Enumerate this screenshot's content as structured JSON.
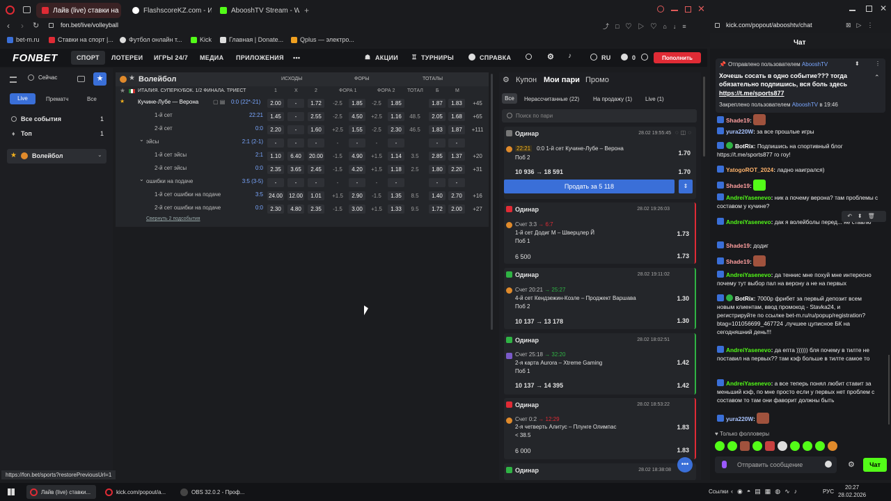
{
  "browser": {
    "tabs": [
      {
        "label": "Лайв (live) ставки на Вол",
        "color": "#e02b35",
        "active": true
      },
      {
        "label": "FlashscoreKZ.com - Избр",
        "color": "#ffffff",
        "active": false
      },
      {
        "label": "AbooshTV Stream - Watch",
        "color": "#53fc18",
        "active": false
      }
    ],
    "url_left": "fon.bet/live/volleyball",
    "url_right": "kick.com/popout/abooshtv/chat",
    "bookmarks": [
      "bet-m.ru",
      "Ставки на спорт |...",
      "Футбол онлайн т...",
      "Kick",
      "Главная | Donate...",
      "Qplus — электро..."
    ],
    "status_url": "https://fon.bet/sports?restorePreviousUrl=1"
  },
  "fonbet": {
    "logo": "FONBET",
    "nav": [
      "СПОРТ",
      "ЛОТЕРЕИ",
      "ИГРЫ 24/7",
      "МЕДИА",
      "ПРИЛОЖЕНИЯ",
      "•••"
    ],
    "actions": [
      "АКЦИИ",
      "ТУРНИРЫ",
      "СПРАВКА"
    ],
    "lang": "RU",
    "balance": "0",
    "deposit": "Пополнить",
    "sidebar": {
      "now": "Сейчас",
      "filters": [
        "Live",
        "Прематч",
        "Все"
      ],
      "items": [
        {
          "label": "Все события",
          "count": "1"
        },
        {
          "label": "Топ",
          "count": "1"
        }
      ],
      "sport": "Волейбол"
    },
    "table": {
      "sport": "Волейбол",
      "groups": [
        "ИСХОДЫ",
        "ФОРЫ",
        "ТОТАЛЫ"
      ],
      "league": "ИТАЛИЯ. СУПЕРКУБОК. 1/2 ФИНАЛА. ТРИЕСТ",
      "cols": [
        "1",
        "X",
        "2",
        "ФОРА 1",
        "ФОРА 2",
        "ТОТАЛ",
        "Б",
        "М"
      ],
      "rows": [
        {
          "name": "Кучине-Лубе — Верона",
          "score": "0:0 (22*-21)",
          "c": [
            "2.00",
            "-",
            "1.72",
            "-2.5",
            "1.85",
            "-2.5",
            "1.85",
            "",
            "1.87",
            "1.83",
            "+45"
          ],
          "main": true
        },
        {
          "name": "1-й сет",
          "score": "22:21",
          "c": [
            "1.45",
            "-",
            "2.55",
            "-2.5",
            "4.50",
            "+2.5",
            "1.16",
            "48.5",
            "2.05",
            "1.68",
            "+65"
          ]
        },
        {
          "name": "2-й сет",
          "score": "0:0",
          "c": [
            "2.20",
            "-",
            "1.60",
            "+2.5",
            "1.55",
            "-2.5",
            "2.30",
            "46.5",
            "1.83",
            "1.87",
            "+111"
          ]
        },
        {
          "name": "эйсы",
          "score": "2:1 (2-1)",
          "c": [
            "-",
            "-",
            "-",
            "-",
            "-",
            "-",
            "-",
            "",
            "-",
            "-",
            ""
          ],
          "group": true
        },
        {
          "name": "1-й сет эйсы",
          "score": "2:1",
          "c": [
            "1.10",
            "6.40",
            "20.00",
            "-1.5",
            "4.90",
            "+1.5",
            "1.14",
            "3.5",
            "2.85",
            "1.37",
            "+20"
          ]
        },
        {
          "name": "2-й сет эйсы",
          "score": "0:0",
          "c": [
            "2.35",
            "3.65",
            "2.45",
            "-1.5",
            "4.20",
            "+1.5",
            "1.18",
            "2.5",
            "1.80",
            "2.20",
            "+31"
          ]
        },
        {
          "name": "ошибки на подаче",
          "score": "3:5 (3-5)",
          "c": [
            "-",
            "-",
            "-",
            "-",
            "-",
            "-",
            "-",
            "",
            "-",
            "-",
            ""
          ],
          "group": true
        },
        {
          "name": "1-й сет ошибки на подаче",
          "score": "3:5",
          "c": [
            "24.00",
            "12.00",
            "1.01",
            "+1.5",
            "2.90",
            "-1.5",
            "1.35",
            "8.5",
            "1.40",
            "2.70",
            "+16"
          ]
        },
        {
          "name": "2-й сет ошибки на подаче",
          "score": "0:0",
          "c": [
            "2.30",
            "4.80",
            "2.35",
            "-1.5",
            "3.00",
            "+1.5",
            "1.33",
            "9.5",
            "1.72",
            "2.00",
            "+27"
          ]
        }
      ],
      "collapse": "Свернуть 2 подсобытия"
    },
    "coupon": {
      "tabs": [
        "Купон",
        "Мои пари",
        "Промо"
      ],
      "filters": [
        "Все",
        "Нерассчитанные (22)",
        "На продажу (1)",
        "Live (1)"
      ],
      "search_placeholder": "Поиск по пари",
      "sell_button": "Продать за 5 118",
      "bets": [
        {
          "type": "Одинар",
          "date": "28.02 19:55:45",
          "status": "#777777",
          "score": "22:21",
          "event": "0:0 1-й сет Кучине-Лубе – Верона",
          "pick": "Поб 2",
          "k": "1.70",
          "stake": "10 936 → 18 591",
          "k2": "1.70"
        },
        {
          "type": "Одинар",
          "date": "28.02 19:26:03",
          "status": "#e02b35",
          "score": "Счет 3:3",
          "score_live": "→ 6:7",
          "event": "1-й сет Додиг М – Шверцлер Й",
          "pick": "Поб 1",
          "k": "1.73",
          "stake": "6 500",
          "k2": "1.73"
        },
        {
          "type": "Одинар",
          "date": "28.02 19:11:02",
          "status": "#2fb344",
          "score": "Счет 20:21",
          "score_live": "→ 25:27",
          "event": "4-й сет Кендзежин-Козле – Проджект Варшава",
          "pick": "Поб 2",
          "k": "1.30",
          "stake": "10 137 → 13 178",
          "k2": "1.30"
        },
        {
          "type": "Одинар",
          "date": "28.02 18:02:51",
          "status": "#2fb344",
          "score": "Счет 25:18",
          "score_live": "→ 32:20",
          "event": "2-я карта Aurora – Xtreme Gaming",
          "pick": "Поб 1",
          "k": "1.42",
          "stake": "10 137 → 14 395",
          "k2": "1.42"
        },
        {
          "type": "Одинар",
          "date": "28.02 18:53:22",
          "status": "#e02b35",
          "score": "Счет 0:2",
          "score_live": "→ 12:29",
          "event": "2-я четверть Алитус – Плунге Олимпас",
          "pick": "< 38.5",
          "k": "1.83",
          "stake": "6 000",
          "k2": "1.83"
        },
        {
          "type": "Одинар",
          "date": "28.02 18:38:08",
          "status": "#2fb344"
        }
      ]
    }
  },
  "chat": {
    "title": "Чат",
    "pinned_by": "Отправлено пользователем",
    "pinned_user": "AbooshTV",
    "pinned_text": "Хочешь сосать в одно событие??? тогда обязательно подпишись, вся боль здесь",
    "pinned_link": "https://t.me/sports877",
    "pinned_footer": "Закреплено пользователем",
    "pinned_footer_user": "AbooshTV",
    "pinned_footer_time": "в 19:46",
    "messages": [
      {
        "user": "Shade19",
        "color": "#ff9f9f",
        "text": ""
      },
      {
        "user": "yura220W",
        "color": "#a9c4ff",
        "text": "за все прошлые игры"
      },
      {
        "user": "BotRix",
        "color": "#ffffff",
        "text": "Подпишись на спортивный блог https://t.me/sports877 го гоу!"
      },
      {
        "user": "YatogoROT_2024",
        "color": "#ffb36b",
        "text": "ладно наигрался)"
      },
      {
        "user": "Shade19",
        "color": "#ff9f9f",
        "text": ""
      },
      {
        "user": "AndreiYasenevo",
        "color": "#53fc18",
        "text": "ник а почему верона? там проблемы с составом у кучине?"
      },
      {
        "user": "AndreiYasenevo",
        "color": "#53fc18",
        "text": "дак я волейболы перед... не ставлю"
      },
      {
        "user": "Shade19",
        "color": "#ff9f9f",
        "text": "додиг"
      },
      {
        "user": "Shade19",
        "color": "#ff9f9f",
        "text": ""
      },
      {
        "user": "AndreiYasenevo",
        "color": "#53fc18",
        "text": "да теннис мне похуй мне интересно почему тут выбор пал на верону а не на первых"
      },
      {
        "user": "BotRix",
        "color": "#ffffff",
        "text": "7000р фрибет за первый депозит всем новым клиентам, ввод промокод - Stavka24, и регистрируйте по ссылке bet-m.ru/ru/popup/registration?btag=101056699_467724 ,лучшее цуписное БК на сегодняшний день!!!"
      },
      {
        "user": "AndreiYasenevo",
        "color": "#53fc18",
        "text": "да епта )))))) бля почему в тилте не поставил на первых?? там кэф больше в тилте самое то"
      },
      {
        "user": "AndreiYasenevo",
        "color": "#53fc18",
        "text": "а все теперь понял любит ставит за меньший кэф, по мне просто если у первых нет проблем с составом то там они фаворит должны быть"
      },
      {
        "user": "yura220W",
        "color": "#a9c4ff",
        "text": ""
      }
    ],
    "followers_only": "Только фолловеры",
    "input_placeholder": "Отправить сообщение",
    "send": "Чат"
  },
  "taskbar": {
    "items": [
      "Лайв (live) ставки...",
      "kick.com/popout/a...",
      "OBS 32.0.2 - Проф..."
    ],
    "links": "Ссылки",
    "lang": "РУС",
    "time": "20:27",
    "date": "28.02.2026"
  },
  "colors": {
    "accent": "#e02b35",
    "kick": "#53fc18",
    "sell": "#3a6fd8"
  }
}
